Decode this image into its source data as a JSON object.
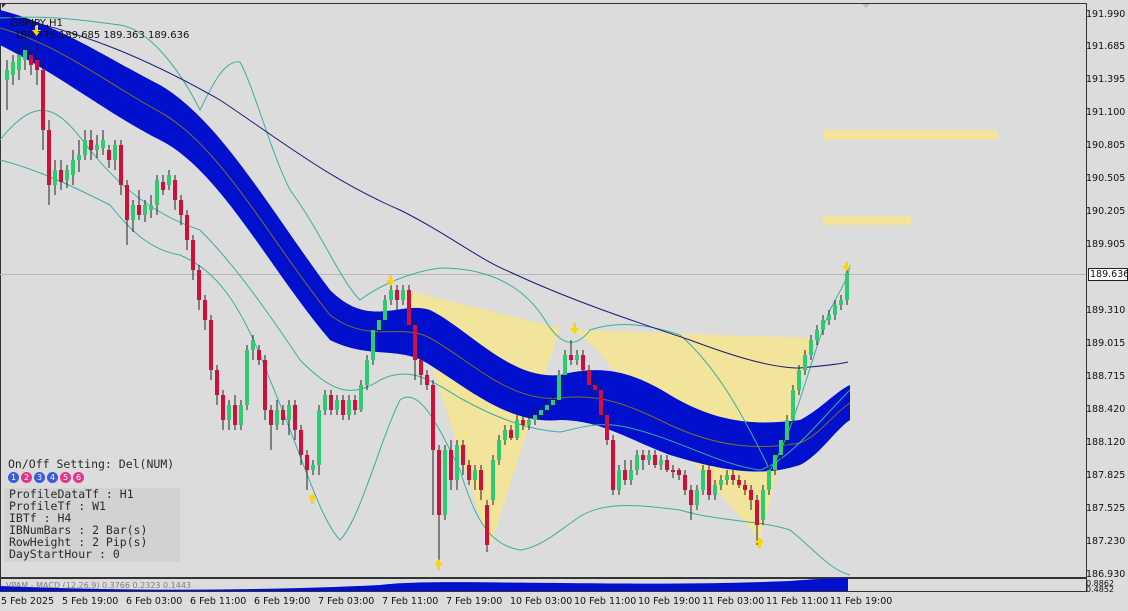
{
  "header": {
    "symbol_text": "GBPJPY,H1",
    "ohlc_text": "189.375 189.685 189.363 189.636"
  },
  "price_axis": {
    "labels": [
      "191.990",
      "191.685",
      "191.395",
      "191.100",
      "190.805",
      "190.505",
      "190.205",
      "189.905",
      "189.310",
      "189.015",
      "188.715",
      "188.420",
      "188.120",
      "187.825",
      "187.525",
      "187.230",
      "186.930"
    ],
    "current_price": "189.636",
    "sub_labels": [
      "0.8862",
      "0.4852"
    ]
  },
  "time_axis": {
    "labels": [
      "5 Feb 2025",
      "5 Feb 19:00",
      "6 Feb 03:00",
      "6 Feb 11:00",
      "6 Feb 19:00",
      "7 Feb 03:00",
      "7 Feb 11:00",
      "7 Feb 19:00",
      "10 Feb 03:00",
      "10 Feb 11:00",
      "10 Feb 19:00",
      "11 Feb 03:00",
      "11 Feb 11:00",
      "11 Feb 19:00"
    ]
  },
  "indicator_subwindow_text": "VPAM - MACD (12,26,9) 0.3766 0.2323 0.1443",
  "settings_panel": {
    "onoff": "On/Off Setting: Del(NUM)",
    "badges": [
      {
        "label": "1",
        "color": "#3b5bdb"
      },
      {
        "label": "2",
        "color": "#e0358a"
      },
      {
        "label": "3",
        "color": "#3b5bdb"
      },
      {
        "label": "4",
        "color": "#3b5bdb"
      },
      {
        "label": "5",
        "color": "#e0358a"
      },
      {
        "label": "6",
        "color": "#e0358a"
      }
    ],
    "rows": [
      "ProfileDataTf : H1",
      "ProfileTf     : W1",
      "IBTf          : H4",
      "IBNumBars     : 2 Bar(s)",
      "RowHeight     : 2 Pip(s)",
      "DayStartHour  : 0"
    ]
  },
  "colors": {
    "background": "#dcdcdc",
    "bull_candle": "#2ecc71",
    "bear_candle": "#d0103a",
    "channel_fill": "#0010cc",
    "bollinger": "#3aaea0",
    "ma_line": "#1a1a7a",
    "pattern_fill": "#f2e49a",
    "arrow": "#ffd400"
  }
}
